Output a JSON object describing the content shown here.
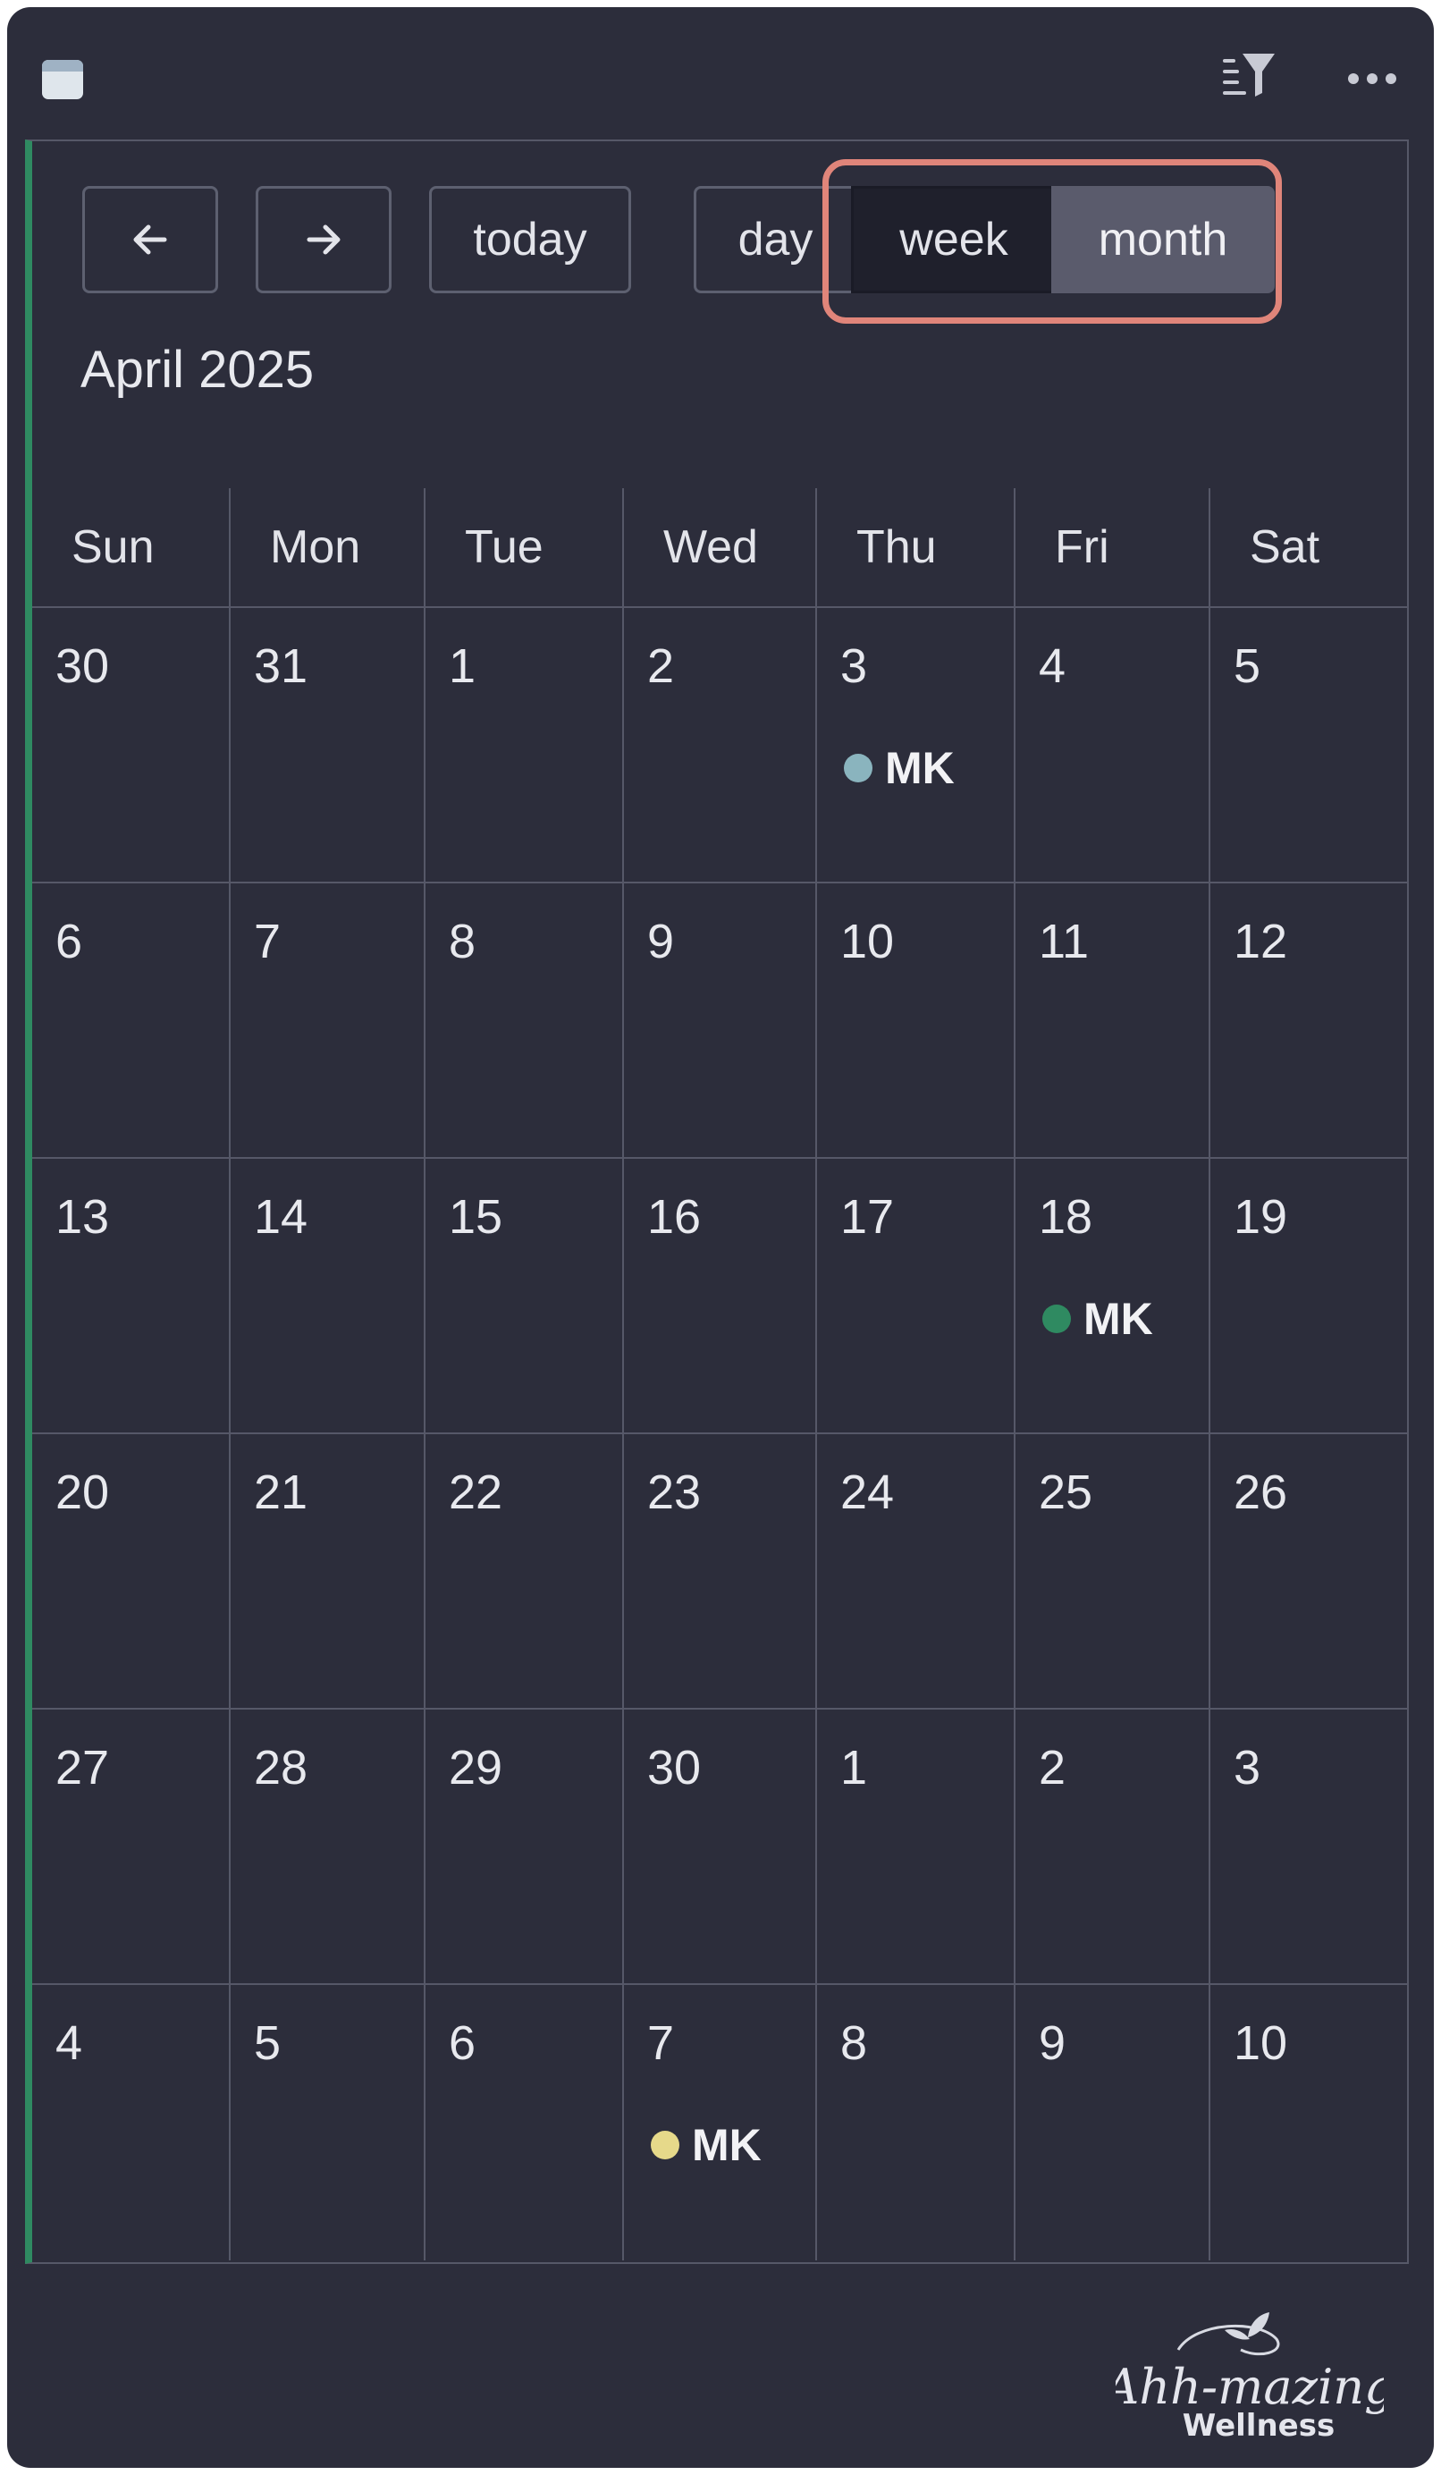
{
  "toolbar": {
    "prev_icon": "arrow-left-icon",
    "next_icon": "arrow-right-icon",
    "today_label": "today",
    "day_label": "day",
    "week_label": "week",
    "month_label": "month",
    "active_view": "month",
    "highlight_color": "#e0857a"
  },
  "calendar": {
    "title": "April 2025",
    "weekdays": [
      "Sun",
      "Mon",
      "Tue",
      "Wed",
      "Thu",
      "Fri",
      "Sat"
    ],
    "weeks": [
      [
        {
          "day": "30"
        },
        {
          "day": "31"
        },
        {
          "day": "1"
        },
        {
          "day": "2"
        },
        {
          "day": "3",
          "event": {
            "label": "MK",
            "color": "#8ab4be"
          }
        },
        {
          "day": "4"
        },
        {
          "day": "5"
        }
      ],
      [
        {
          "day": "6"
        },
        {
          "day": "7"
        },
        {
          "day": "8"
        },
        {
          "day": "9"
        },
        {
          "day": "10"
        },
        {
          "day": "11"
        },
        {
          "day": "12"
        }
      ],
      [
        {
          "day": "13"
        },
        {
          "day": "14"
        },
        {
          "day": "15"
        },
        {
          "day": "16"
        },
        {
          "day": "17"
        },
        {
          "day": "18",
          "event": {
            "label": "MK",
            "color": "#2f8a61"
          }
        },
        {
          "day": "19"
        }
      ],
      [
        {
          "day": "20"
        },
        {
          "day": "21"
        },
        {
          "day": "22"
        },
        {
          "day": "23"
        },
        {
          "day": "24"
        },
        {
          "day": "25"
        },
        {
          "day": "26"
        }
      ],
      [
        {
          "day": "27"
        },
        {
          "day": "28"
        },
        {
          "day": "29"
        },
        {
          "day": "30"
        },
        {
          "day": "1"
        },
        {
          "day": "2"
        },
        {
          "day": "3"
        }
      ],
      [
        {
          "day": "4"
        },
        {
          "day": "5"
        },
        {
          "day": "6"
        },
        {
          "day": "7",
          "event": {
            "label": "MK",
            "color": "#e6d98a"
          }
        },
        {
          "day": "8"
        },
        {
          "day": "9"
        },
        {
          "day": "10"
        }
      ]
    ]
  },
  "logo": {
    "text_line1": "Ahh-mazing",
    "text_line2": "Wellness"
  },
  "colors": {
    "background": "#2c2d3b",
    "accent": "#2f8a61"
  }
}
